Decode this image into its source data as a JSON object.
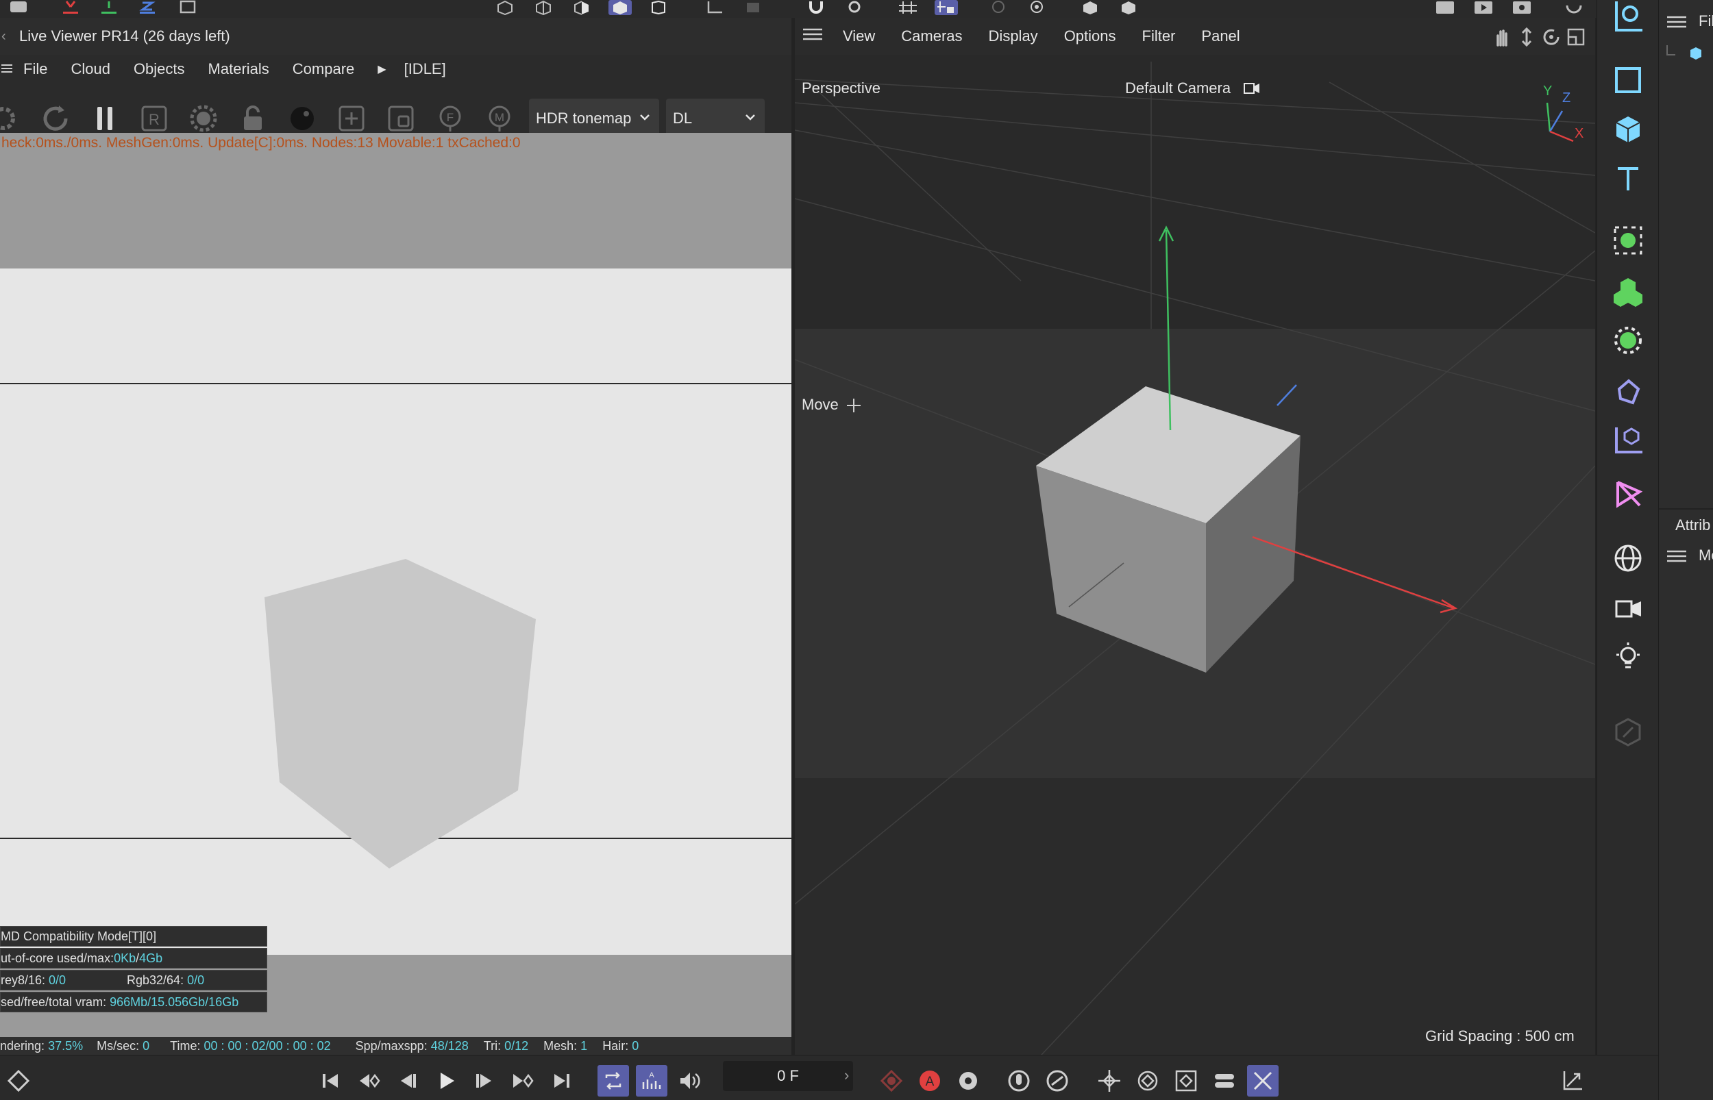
{
  "live_viewer": {
    "title": "Live Viewer PR14 (26 days left)",
    "menu": [
      "File",
      "Cloud",
      "Objects",
      "Materials",
      "Compare"
    ],
    "state": "[IDLE]",
    "tonemap_select": "HDR tonemap",
    "kernel_select": "DL",
    "stat_line": "heck:0ms./0ms. MeshGen:0ms. Update[C]:0ms. Nodes:13 Movable:1 txCached:0",
    "overlay": {
      "compat": "MD Compatibility Mode[T][0]",
      "ooc_label": "ut-of-core used/max:",
      "ooc_used": "0Kb",
      "ooc_max": "4Gb",
      "grey_label": "rey8/16: ",
      "grey_val": "0/0",
      "rgb_label": "Rgb32/64: ",
      "rgb_val": "0/0",
      "vram_label": "sed/free/total vram: ",
      "vram_val": "966Mb/15.056Gb/16Gb"
    },
    "bottom": {
      "rendering_label": "ndering: ",
      "rendering_val": "37.5%",
      "mssec_label": "Ms/sec: ",
      "mssec_val": "0",
      "time_label": "Time: ",
      "time_val": "00 : 00 : 02/00 : 00 : 02",
      "spp_label": "Spp/maxspp: ",
      "spp_val": "48/128",
      "tri_label": "Tri: ",
      "tri_val": "0/12",
      "mesh_label": "Mesh: ",
      "mesh_val": "1",
      "hair_label": "Hair: ",
      "hair_val": "0"
    }
  },
  "viewport": {
    "menu": [
      "View",
      "Cameras",
      "Display",
      "Options",
      "Filter",
      "Panel"
    ],
    "projection": "Perspective",
    "camera": "Default Camera",
    "tool": "Move",
    "grid_spacing": "Grid Spacing : 500 cm",
    "axes": {
      "x": "X",
      "y": "Y",
      "z": "Z"
    }
  },
  "right_panel": {
    "top_label": "Fil",
    "attr_label": "Attrib",
    "mode_label": "Mo"
  },
  "timeline": {
    "frame": "0 F"
  },
  "colors": {
    "accent": "#5a5fa8",
    "cyan": "#5fd3e0",
    "stat_text": "#b5511c",
    "axis_x": "#e04040",
    "axis_y": "#3fc060",
    "axis_z": "#4f7fe0"
  }
}
